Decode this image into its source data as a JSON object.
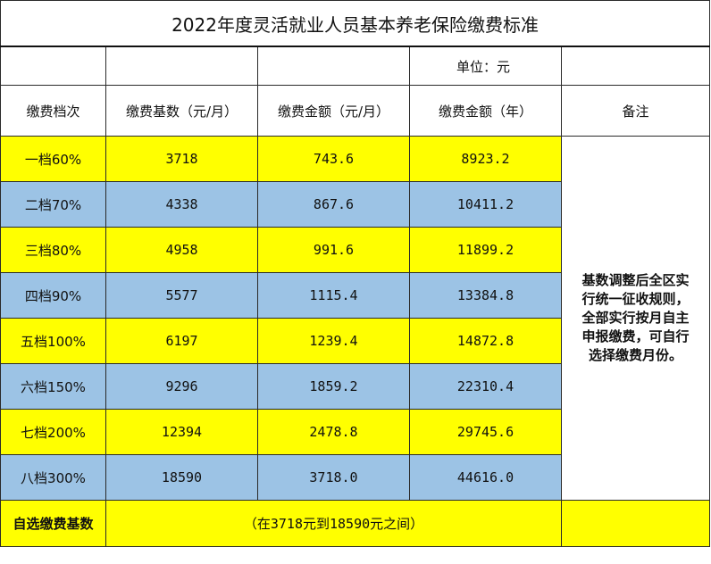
{
  "title": "2022年度灵活就业人员基本养老保险缴费标准",
  "unit": "单位：元",
  "headers": [
    "缴费档次",
    "缴费基数（元/月）",
    "缴费金额（元/月）",
    "缴费金额（年）",
    "备注"
  ],
  "rows": [
    {
      "level": "一档60%",
      "base": "3718",
      "monthly": "743.6",
      "yearly": "8923.2"
    },
    {
      "level": "二档70%",
      "base": "4338",
      "monthly": "867.6",
      "yearly": "10411.2"
    },
    {
      "level": "三档80%",
      "base": "4958",
      "monthly": "991.6",
      "yearly": "11899.2"
    },
    {
      "level": "四档90%",
      "base": "5577",
      "monthly": "1115.4",
      "yearly": "13384.8"
    },
    {
      "level": "五档100%",
      "base": "6197",
      "monthly": "1239.4",
      "yearly": "14872.8"
    },
    {
      "level": "六档150%",
      "base": "9296",
      "monthly": "1859.2",
      "yearly": "22310.4"
    },
    {
      "level": "七档200%",
      "base": "12394",
      "monthly": "2478.8",
      "yearly": "29745.6"
    },
    {
      "level": "八档300%",
      "base": "18590",
      "monthly": "3718.0",
      "yearly": "44616.0"
    }
  ],
  "note_lines": [
    "基数调整后全区实",
    "行统一征收规则，",
    "全部实行按月自主",
    "申报缴费，可自行",
    "选择缴费月份。"
  ],
  "custom_label": "自选缴费基数",
  "custom_range": "（在3718元到18590元之间）",
  "colors": {
    "yellow": "#ffff00",
    "blue": "#9cc3e5"
  }
}
